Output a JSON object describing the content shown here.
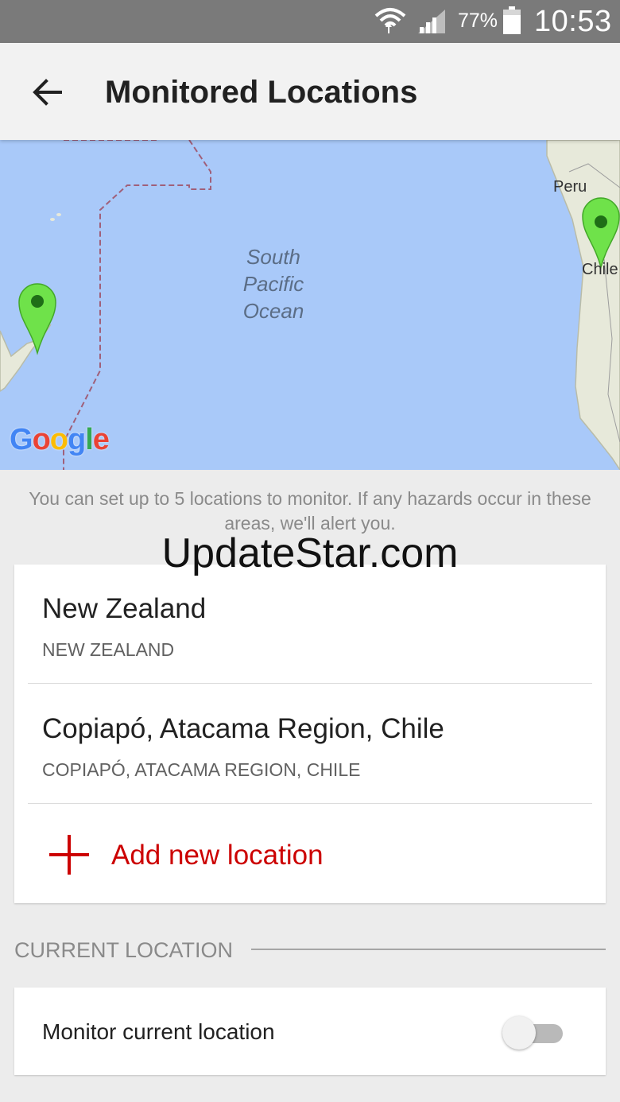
{
  "status_bar": {
    "battery_percent": "77%",
    "time": "10:53",
    "icons": [
      "wifi-icon",
      "signal-icon",
      "battery-icon"
    ]
  },
  "app_bar": {
    "back_icon": "arrow-left-icon",
    "title": "Monitored Locations"
  },
  "map": {
    "ocean_label": "South Pacific Ocean",
    "country_labels": [
      "Peru",
      "Chile"
    ],
    "logo_text": "Google",
    "marker_color": "#6fe24a",
    "water_color": "#a9c9f9"
  },
  "info_text": "You can set up to 5 locations to monitor. If any hazards occur in these areas, we'll alert you.",
  "watermark": "UpdateStar.com",
  "locations": [
    {
      "name": "New Zealand",
      "subtitle": "NEW ZEALAND"
    },
    {
      "name": "Copiapó, Atacama Region, Chile",
      "subtitle": "COPIAPÓ, ATACAMA REGION, CHILE"
    }
  ],
  "add_location": {
    "label": "Add new location",
    "icon": "plus-icon",
    "color": "#cc0000"
  },
  "current_location": {
    "section_title": "CURRENT LOCATION",
    "toggle_label": "Monitor current location",
    "toggle_on": false
  }
}
